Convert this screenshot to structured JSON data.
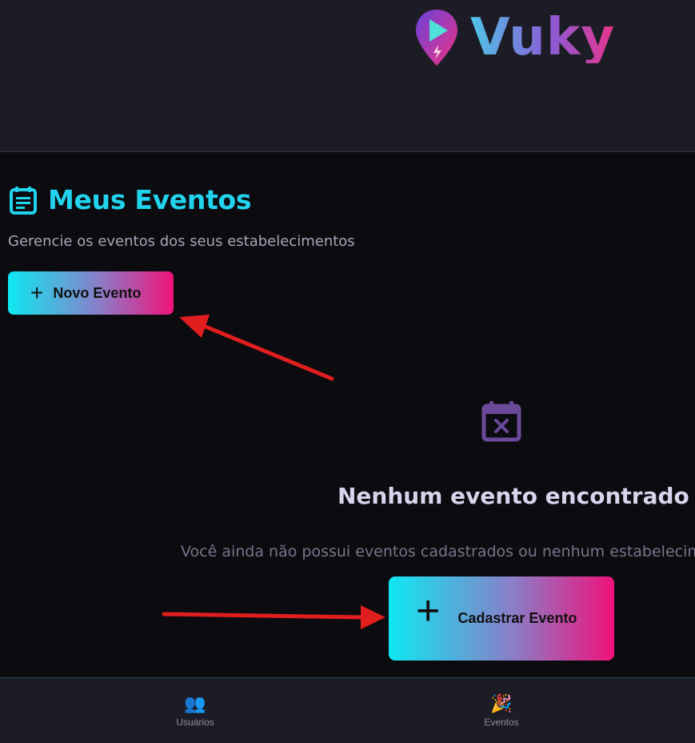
{
  "header": {
    "brand_name": "Vuky"
  },
  "page": {
    "title": "Meus Eventos",
    "subtitle": "Gerencie os eventos dos seus estabelecimentos",
    "new_event_label": "Novo Evento"
  },
  "empty_state": {
    "title": "Nenhum evento encontrado",
    "description": "Você ainda não possui eventos cadastrados ou nenhum estabelecime",
    "register_label": "Cadastrar Evento"
  },
  "bottom_nav": {
    "items": [
      {
        "label": "Usuários",
        "icon": "users-icon",
        "glyph": "👥"
      },
      {
        "label": "Eventos",
        "icon": "party-popper-icon",
        "glyph": "🎉"
      }
    ]
  },
  "colors": {
    "accent_cyan": "#22d3ee",
    "gradient_start": "#0ee8f2",
    "gradient_end": "#f0127a",
    "annotation_arrow": "#e01e1e"
  }
}
